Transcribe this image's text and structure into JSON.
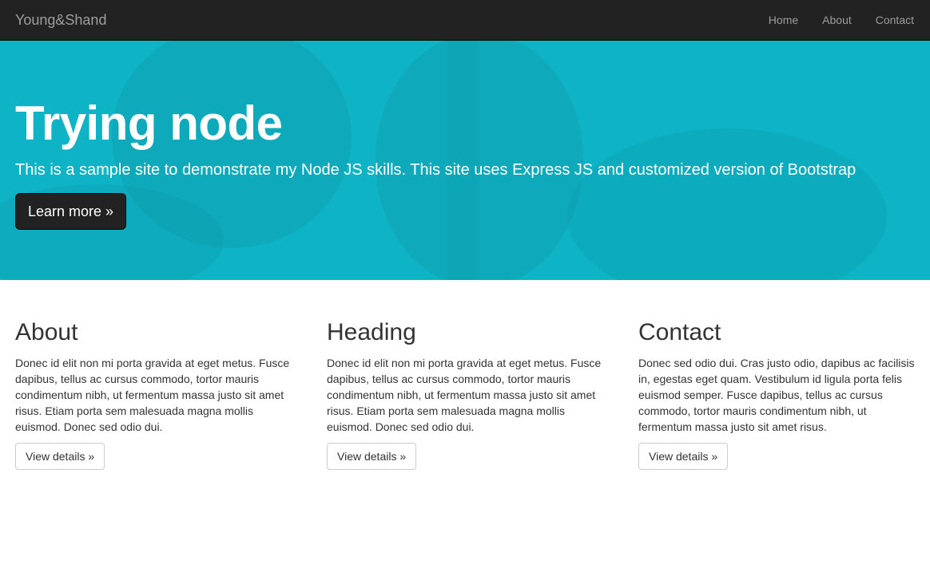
{
  "navbar": {
    "brand": "Young&Shand",
    "links": [
      "Home",
      "About",
      "Contact"
    ]
  },
  "hero": {
    "title": "Trying node",
    "subtitle": "This is a sample site to demonstrate my Node JS skills. This site uses Express JS and customized version of Bootstrap",
    "button_label": "Learn more »"
  },
  "columns": [
    {
      "heading": "About",
      "text": "Donec id elit non mi porta gravida at eget metus. Fusce dapibus, tellus ac cursus commodo, tortor mauris condimentum nibh, ut fermentum massa justo sit amet risus. Etiam porta sem malesuada magna mollis euismod. Donec sed odio dui.",
      "button_label": "View details »"
    },
    {
      "heading": "Heading",
      "text": "Donec id elit non mi porta gravida at eget metus. Fusce dapibus, tellus ac cursus commodo, tortor mauris condimentum nibh, ut fermentum massa justo sit amet risus. Etiam porta sem malesuada magna mollis euismod. Donec sed odio dui.",
      "button_label": "View details »"
    },
    {
      "heading": "Contact",
      "text": "Donec sed odio dui. Cras justo odio, dapibus ac facilisis in, egestas eget quam. Vestibulum id ligula porta felis euismod semper. Fusce dapibus, tellus ac cursus commodo, tortor mauris condimentum nibh, ut fermentum massa justo sit amet risus.",
      "button_label": "View details »"
    }
  ],
  "colors": {
    "navbar_bg": "#222222",
    "hero_bg": "#10b6c8",
    "hero_button_bg": "#222222"
  }
}
